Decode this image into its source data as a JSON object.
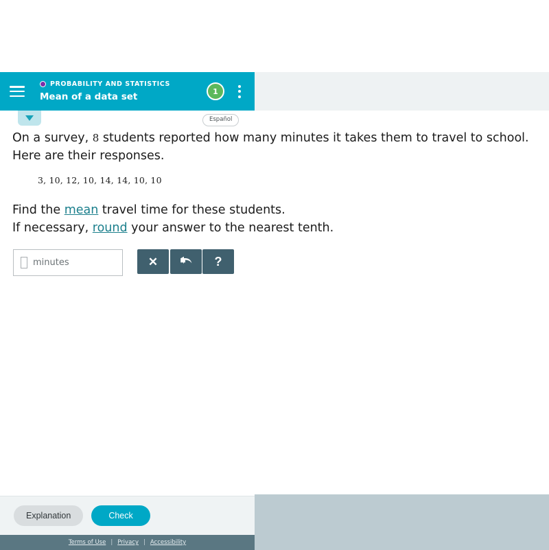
{
  "header": {
    "menu_icon": "hamburger-icon",
    "eyebrow": "PROBABILITY AND STATISTICS",
    "title": "Mean of a data set",
    "topic_dot_color": "#7b2fa8",
    "progress_count": "1",
    "progress_color": "#5cb85c",
    "overflow_icon": "kebab-menu-icon",
    "bar_color": "#00a8c6"
  },
  "subbar": {
    "drawer_toggle_icon": "chevron-down-icon",
    "language_label": "Español"
  },
  "question": {
    "prompt_part1": "On a survey, ",
    "prompt_count": "8",
    "prompt_part2": " students reported how many minutes it takes them to travel to school. Here are their responses.",
    "data_values": "3, 10, 12, 10, 14, 14, 10, 10",
    "instruction_line1_before": "Find the ",
    "instruction_link1": "mean",
    "instruction_line1_after": " travel time for these students.",
    "instruction_line2_before": "If necessary, ",
    "instruction_link2": "round",
    "instruction_line2_after": " your answer to the nearest tenth.",
    "link_color": "#1b7f8c"
  },
  "answer": {
    "value": "",
    "unit_label": "minutes",
    "tools": [
      {
        "name": "clear-button",
        "glyph": "✕",
        "icon": "close-x-icon"
      },
      {
        "name": "undo-button",
        "glyph": "",
        "icon": "undo-arrow-icon"
      },
      {
        "name": "help-button",
        "glyph": "?",
        "icon": "question-mark-icon"
      }
    ],
    "tool_color": "#40606e"
  },
  "actions": {
    "explanation_label": "Explanation",
    "check_label": "Check",
    "check_color": "#00a8c6"
  },
  "footer": {
    "terms_label": "Terms of Use",
    "privacy_label": "Privacy",
    "accessibility_label": "Accessibility",
    "separator": "|",
    "bar_color": "#5a7782"
  }
}
